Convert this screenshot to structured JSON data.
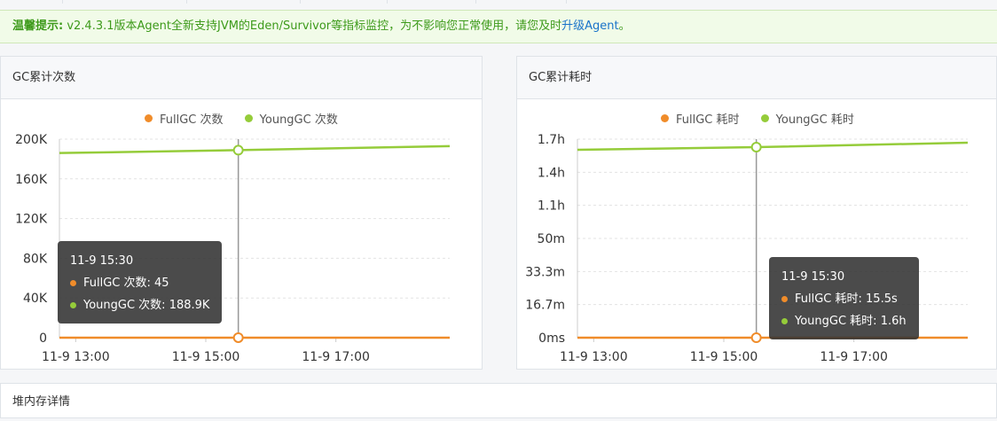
{
  "notice": {
    "label": "温馨提示:",
    "text_before": " v2.4.3.1版本Agent全新支持JVM的Eden/Survivor等指标监控，为不影响您正常使用，请您及时",
    "link": "升级Agent",
    "text_after": "。"
  },
  "colors": {
    "fullgc": "#f08c2a",
    "younggc": "#95cc3a"
  },
  "panels": {
    "count": {
      "title": "GC累计次数",
      "legend": [
        "FullGC 次数",
        "YoungGC 次数"
      ],
      "tooltip": {
        "time": "11-9 15:30",
        "fullgc": "FullGC 次数:  45",
        "younggc": "YoungGC 次数:  188.9K"
      }
    },
    "time": {
      "title": "GC累计耗时",
      "legend": [
        "FullGC 耗时",
        "YoungGC 耗时"
      ],
      "tooltip": {
        "time": "11-9 15:30",
        "fullgc": "FullGC 耗时:  15.5s",
        "younggc": "YoungGC 耗时:  1.6h"
      }
    }
  },
  "bottom_panel": {
    "title": "堆内存详情"
  },
  "chart_data": [
    {
      "type": "line",
      "title": "GC累计次数",
      "x_ticks": [
        "11-9 13:00",
        "11-9 15:00",
        "11-9 17:00"
      ],
      "y_ticks": [
        "200K",
        "160K",
        "120K",
        "80K",
        "40K",
        "0"
      ],
      "ylim": [
        0,
        200000
      ],
      "x_range_hours": [
        12.75,
        18.75
      ],
      "hover_x": 15.5,
      "series": [
        {
          "name": "FullGC 次数",
          "x": [
            12.75,
            15.5,
            18.75
          ],
          "y": [
            45,
            45,
            45
          ]
        },
        {
          "name": "YoungGC 次数",
          "x": [
            12.75,
            15.5,
            18.75
          ],
          "y": [
            186000,
            188900,
            193000
          ]
        }
      ],
      "legend": "top-center",
      "grid": true
    },
    {
      "type": "line",
      "title": "GC累计耗时",
      "x_ticks": [
        "11-9 13:00",
        "11-9 15:00",
        "11-9 17:00"
      ],
      "y_ticks": [
        "1.7h",
        "1.4h",
        "1.1h",
        "50m",
        "33.3m",
        "16.7m",
        "0ms"
      ],
      "y_scale": "log-like",
      "x_range_hours": [
        12.75,
        18.75
      ],
      "hover_x": 15.5,
      "series": [
        {
          "name": "FullGC 耗时",
          "x": [
            12.75,
            15.5,
            18.75
          ],
          "y_label": [
            "15.5s",
            "15.5s",
            "15.5s"
          ]
        },
        {
          "name": "YoungGC 耗时",
          "x": [
            12.75,
            15.5,
            18.75
          ],
          "y_label": [
            "1.58h",
            "1.6h",
            "1.65h"
          ]
        }
      ],
      "legend": "top-center",
      "grid": true
    }
  ]
}
